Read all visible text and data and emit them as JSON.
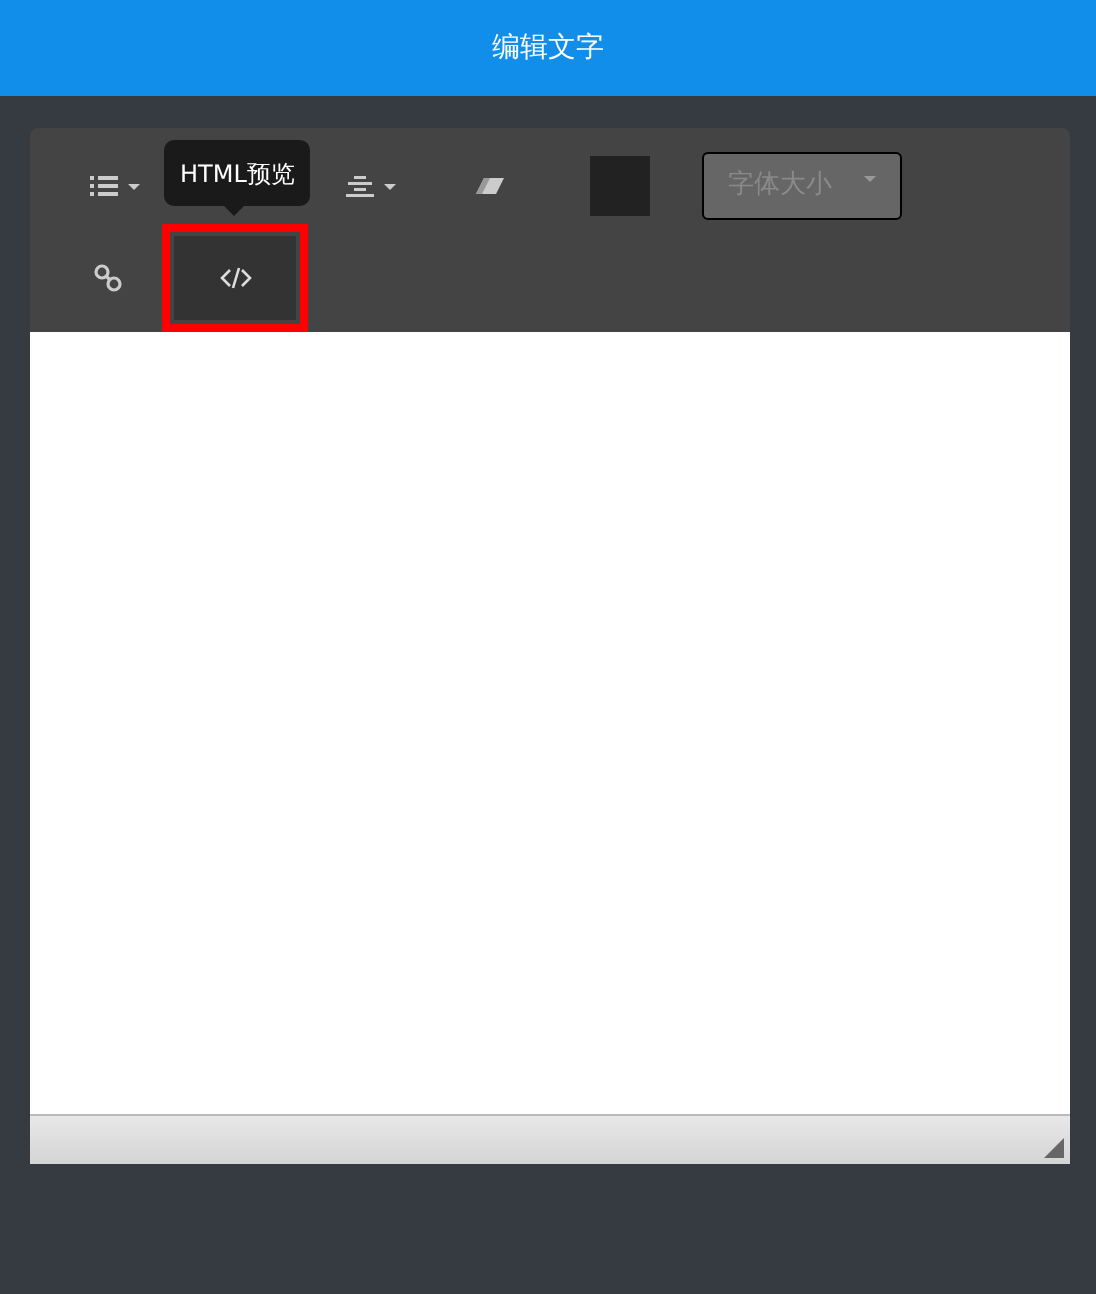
{
  "header": {
    "title": "编辑文字"
  },
  "toolbar": {
    "rows": [
      [
        {
          "kind": "list",
          "dropdown": true,
          "highlighted": false
        },
        {
          "kind": "hidden"
        },
        {
          "kind": "align",
          "dropdown": true,
          "highlighted": false
        },
        {
          "kind": "eraser",
          "dropdown": false,
          "highlighted": false
        },
        {
          "kind": "color",
          "color": "#222222"
        },
        {
          "kind": "select",
          "placeholder": "字体大小"
        }
      ],
      [
        {
          "kind": "link",
          "dropdown": false,
          "highlighted": false
        },
        {
          "kind": "code",
          "dropdown": false,
          "highlighted": true
        }
      ]
    ],
    "tooltip": "HTML预览"
  }
}
